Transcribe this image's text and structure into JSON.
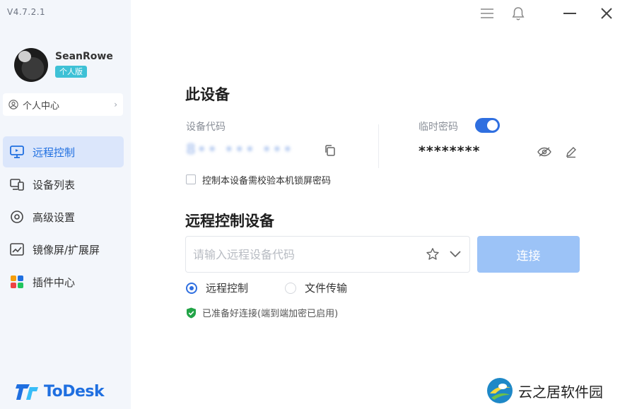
{
  "app": {
    "version": "V4.7.2.1",
    "brand": "ToDesk",
    "accent_color": "#1f6fe0"
  },
  "user": {
    "name": "SeanRowe",
    "plan": "个人版"
  },
  "sidebar": {
    "personal_center": "个人中心",
    "items": [
      {
        "label": "远程控制",
        "icon": "monitor-icon",
        "active": true
      },
      {
        "label": "设备列表",
        "icon": "devices-icon",
        "active": false
      },
      {
        "label": "高级设置",
        "icon": "settings-icon",
        "active": false
      },
      {
        "label": "镜像屏/扩展屏",
        "icon": "screen-mirror-icon",
        "active": false
      },
      {
        "label": "插件中心",
        "icon": "plugins-icon",
        "active": false
      }
    ]
  },
  "this_device": {
    "title": "此设备",
    "code_label": "设备代码",
    "code_value": "8•• ••• •••",
    "temp_password_label": "临时密码",
    "temp_password_enabled": true,
    "temp_password_value": "********",
    "lock_screen_checkbox": "控制本设备需校验本机锁屏密码",
    "lock_screen_checked": false
  },
  "remote": {
    "title": "远程控制设备",
    "input_placeholder": "请输入远程设备代码",
    "input_value": "",
    "connect_label": "连接",
    "mode_remote": "远程控制",
    "mode_file": "文件传输",
    "selected_mode": "remote",
    "status": "已准备好连接(端到端加密已启用)"
  },
  "watermark": {
    "text": "云之居软件园"
  }
}
